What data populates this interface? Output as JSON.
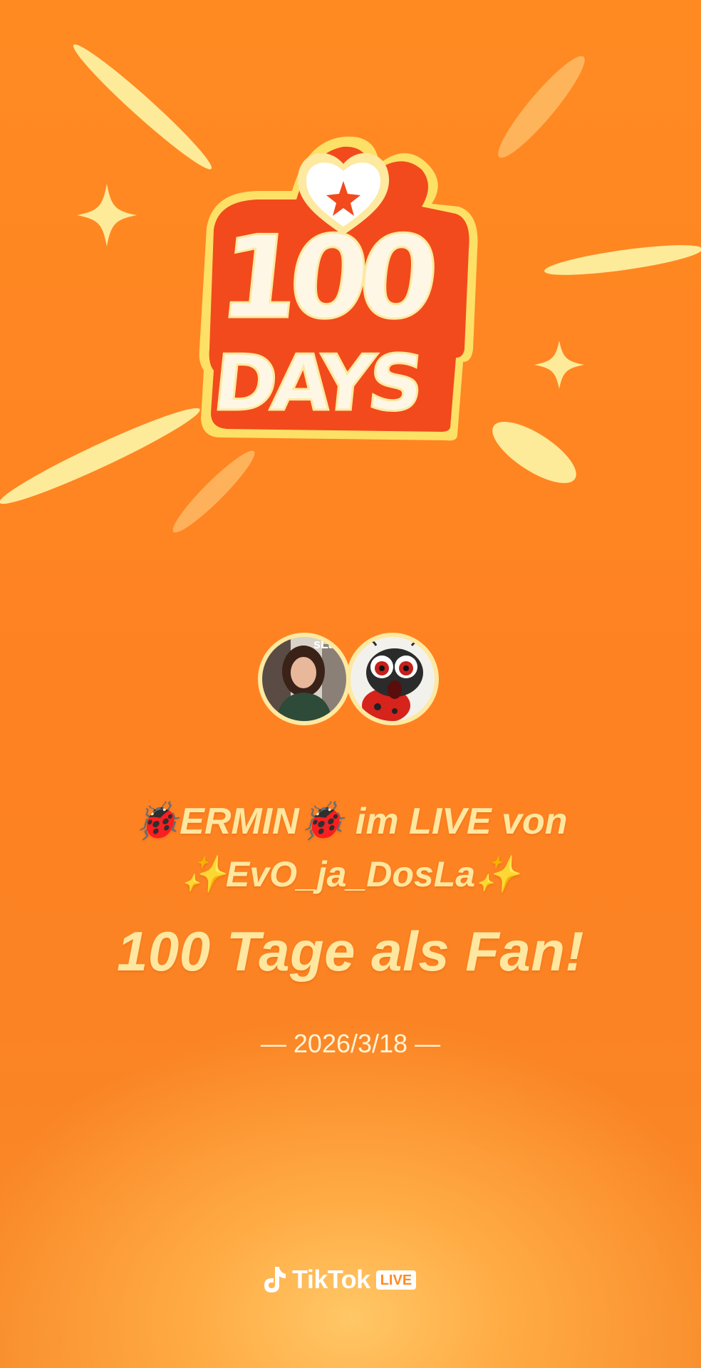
{
  "badge": {
    "number": "100",
    "word": "DAYS"
  },
  "avatars": [
    {
      "name": "streamer-avatar",
      "overlay_text": "sLa"
    },
    {
      "name": "fan-avatar",
      "overlay_text": ""
    }
  ],
  "message": {
    "line1": "🐞ERMIN🐞 im LIVE von",
    "line2": "✨EvO_ja_DosLa✨",
    "headline": "100 Tage als Fan!"
  },
  "date_text": "— 2026/3/18 —",
  "brand": {
    "name": "TikTok",
    "tag": "LIVE"
  },
  "colors": {
    "background": "#ff8a22",
    "text_yellow": "#ffe7a0",
    "badge_red": "#f24a1c",
    "badge_yellow": "#fde9a0"
  },
  "icons": [
    "sparkle-icon",
    "heart-star-icon",
    "tiktok-note-icon"
  ]
}
